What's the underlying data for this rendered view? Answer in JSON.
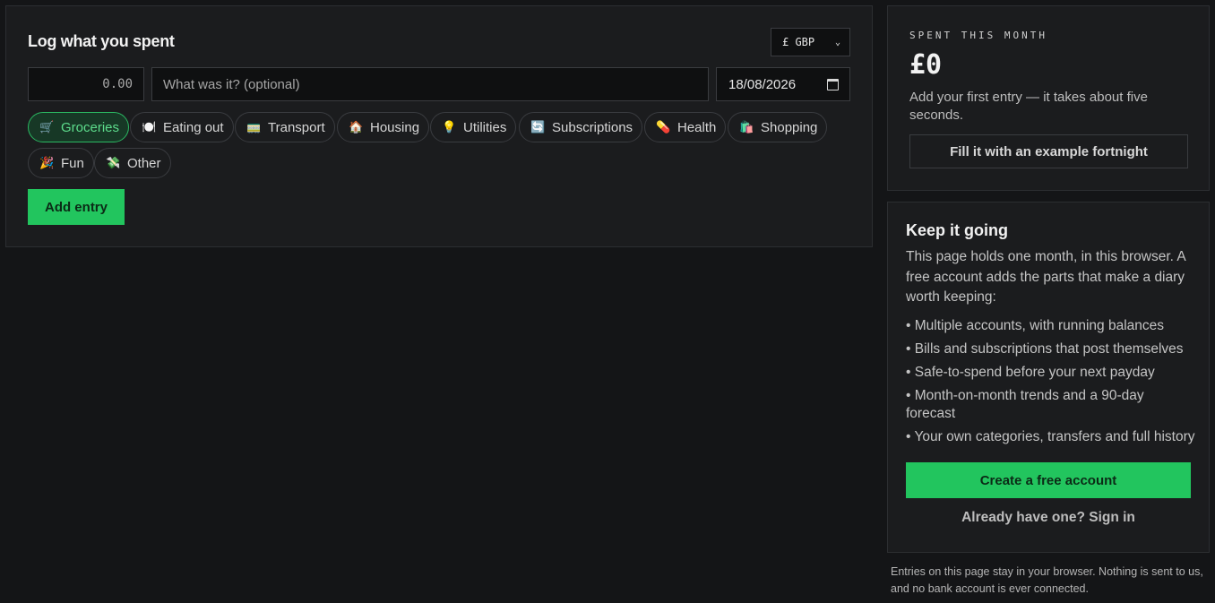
{
  "log": {
    "title": "Log what you spent",
    "currency": "£ GBP",
    "amount_placeholder": "0.00",
    "description_placeholder": "What was it? (optional)",
    "date_value": "18/08/2026",
    "categories": [
      {
        "emoji": "🛒",
        "label": "Groceries",
        "active": true
      },
      {
        "emoji": "🍽️",
        "label": "Eating out",
        "active": false
      },
      {
        "emoji": "🚃",
        "label": "Transport",
        "active": false
      },
      {
        "emoji": "🏠",
        "label": "Housing",
        "active": false
      },
      {
        "emoji": "💡",
        "label": "Utilities",
        "active": false
      },
      {
        "emoji": "🔄",
        "label": "Subscriptions",
        "active": false
      },
      {
        "emoji": "💊",
        "label": "Health",
        "active": false
      },
      {
        "emoji": "🛍️",
        "label": "Shopping",
        "active": false
      },
      {
        "emoji": "🎉",
        "label": "Fun",
        "active": false
      },
      {
        "emoji": "💸",
        "label": "Other",
        "active": false
      }
    ],
    "add_button": "Add entry"
  },
  "summary": {
    "label": "SPENT THIS MONTH",
    "value": "£0",
    "hint": "Add your first entry — it takes about five seconds.",
    "example_button": "Fill it with an example fortnight"
  },
  "keep": {
    "title": "Keep it going",
    "intro": "This page holds one month, in this browser. A free account adds the parts that make a diary worth keeping:",
    "features": [
      "• Multiple accounts, with running balances",
      "• Bills and subscriptions that post themselves",
      "• Safe-to-spend before your next payday",
      "• Month-on-month trends and a 90-day forecast",
      "• Your own categories, transfers and full history"
    ],
    "create_button": "Create a free account",
    "signin_link": "Already have one? Sign in"
  },
  "footer": {
    "note": "Entries on this page stay in your browser. Nothing is sent to us, and no bank account is ever connected."
  },
  "colors": {
    "accent": "#22c55e",
    "background": "#141517",
    "panel": "#1b1c1e"
  }
}
